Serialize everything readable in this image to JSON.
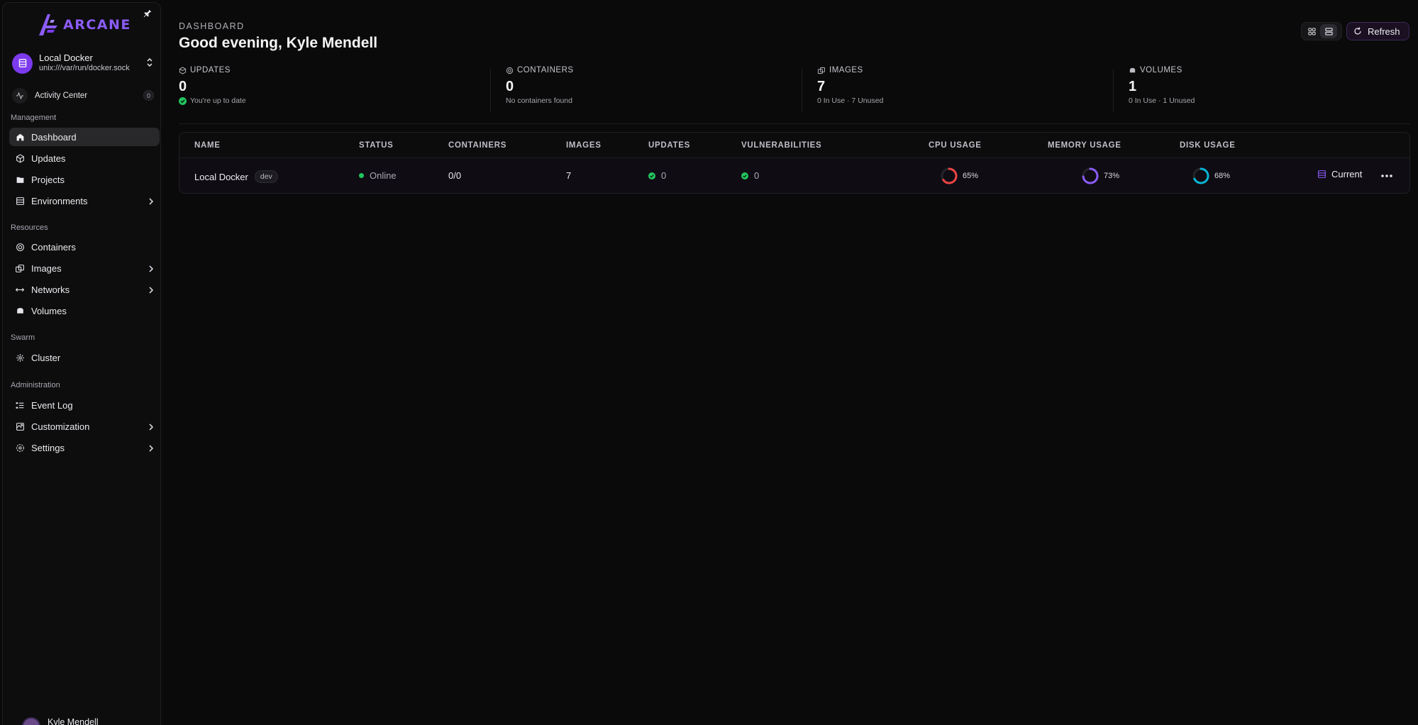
{
  "brand": {
    "name": "ARCANE",
    "accent": "#8b5cf6"
  },
  "environment": {
    "name": "Local Docker",
    "socket": "unix:///var/run/docker.sock"
  },
  "activity": {
    "label": "Activity Center",
    "count": "0"
  },
  "sidebar": {
    "sections": [
      {
        "label": "Management",
        "items": [
          {
            "label": "Dashboard",
            "icon": "home-icon",
            "active": true
          },
          {
            "label": "Updates",
            "icon": "box-icon"
          },
          {
            "label": "Projects",
            "icon": "folder-icon"
          },
          {
            "label": "Environments",
            "icon": "server-icon",
            "chevron": true
          }
        ]
      },
      {
        "label": "Resources",
        "items": [
          {
            "label": "Containers",
            "icon": "container-icon"
          },
          {
            "label": "Images",
            "icon": "images-icon",
            "chevron": true
          },
          {
            "label": "Networks",
            "icon": "network-icon",
            "chevron": true
          },
          {
            "label": "Volumes",
            "icon": "volume-icon"
          }
        ]
      },
      {
        "label": "Swarm",
        "items": [
          {
            "label": "Cluster",
            "icon": "cluster-icon"
          }
        ]
      },
      {
        "label": "Administration",
        "items": [
          {
            "label": "Event Log",
            "icon": "event-log-icon"
          },
          {
            "label": "Customization",
            "icon": "customization-icon",
            "chevron": true
          },
          {
            "label": "Settings",
            "icon": "settings-icon",
            "chevron": true
          }
        ]
      }
    ]
  },
  "user": {
    "name": "Kyle Mendell"
  },
  "header": {
    "kicker": "DASHBOARD",
    "title": "Good evening, Kyle Mendell",
    "refresh_label": "Refresh"
  },
  "stats": [
    {
      "label": "UPDATES",
      "value": "0",
      "sub": "You're up to date",
      "icon": "box-icon",
      "sub_icon": "check-circle-icon"
    },
    {
      "label": "CONTAINERS",
      "value": "0",
      "sub": "No containers found",
      "icon": "container-icon"
    },
    {
      "label": "IMAGES",
      "value": "7",
      "sub": "0 In Use · 7 Unused",
      "icon": "images-icon"
    },
    {
      "label": "VOLUMES",
      "value": "1",
      "sub": "0 In Use · 1 Unused",
      "icon": "volume-icon"
    }
  ],
  "table": {
    "headers": [
      "NAME",
      "STATUS",
      "CONTAINERS",
      "IMAGES",
      "UPDATES",
      "VULNERABILITIES",
      "CPU USAGE",
      "MEMORY USAGE",
      "DISK USAGE"
    ],
    "rows": [
      {
        "name": "Local Docker",
        "tag": "dev",
        "status": "Online",
        "containers": "0/0",
        "images": "7",
        "updates": "0",
        "vulnerabilities": "0",
        "cpu": {
          "label": "65%",
          "value": 0.65,
          "color": "#ef4444"
        },
        "memory": {
          "label": "73%",
          "value": 0.73,
          "color": "#8b5cf6"
        },
        "disk": {
          "label": "68%",
          "value": 0.68,
          "color": "#06b6d4"
        },
        "action": "Current"
      }
    ]
  }
}
